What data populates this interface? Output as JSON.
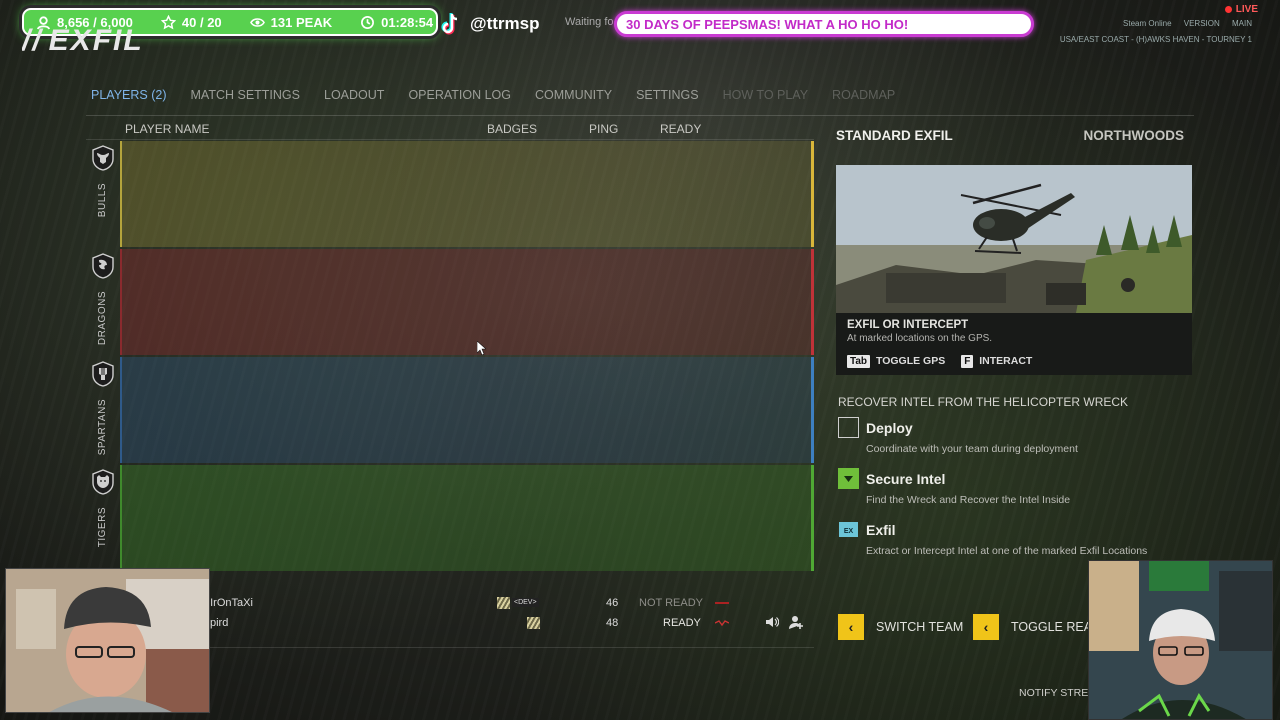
{
  "overlay": {
    "stats": [
      {
        "icon": "user-icon",
        "value": "8,656 / 6,000"
      },
      {
        "icon": "star-icon",
        "value": "40 / 20"
      },
      {
        "icon": "eye-icon",
        "value": "131 PEAK"
      },
      {
        "icon": "clock-icon",
        "value": "01:28:54"
      }
    ],
    "handle": "@ttrmsp",
    "waiting": "Waiting fo",
    "marquee": "30 DAYS OF PEEPSMAS! WHAT A HO HO HO!",
    "live": "LIVE",
    "status_row1": [
      "Steam Online",
      "VERSION",
      "MAIN"
    ],
    "status_row2": "USA/EAST COAST - (H)AWKS HAVEN - TOURNEY 1",
    "stat_color": "#58d14f",
    "marquee_color": "#c93bd2"
  },
  "game": {
    "logo": "EXFIL",
    "tabs": [
      {
        "label": "PLAYERS (2)",
        "state": "active"
      },
      {
        "label": "MATCH SETTINGS",
        "state": "normal"
      },
      {
        "label": "LOADOUT",
        "state": "normal"
      },
      {
        "label": "OPERATION LOG",
        "state": "normal"
      },
      {
        "label": "COMMUNITY",
        "state": "normal"
      },
      {
        "label": "SETTINGS",
        "state": "normal"
      },
      {
        "label": "HOW TO PLAY",
        "state": "dim"
      },
      {
        "label": "ROADMAP",
        "state": "dim"
      }
    ],
    "table_headers": {
      "player_name": "PLAYER NAME",
      "badges": "BADGES",
      "ping": "PING",
      "ready": "READY"
    },
    "teams": [
      {
        "name": "BULLS",
        "color": "#b4a43c",
        "edge": "#d9b63a"
      },
      {
        "name": "DRAGONS",
        "color": "#8a2a2e",
        "edge": "#c03238"
      },
      {
        "name": "SPARTANS",
        "color": "#2f5a8a",
        "edge": "#3d7fc0"
      },
      {
        "name": "TIGERS",
        "color": "#3f8a2c",
        "edge": "#4fa834"
      }
    ],
    "players": [
      {
        "name": "] IrOnTaXi",
        "dev_tag": "<DEV>",
        "ping": "46",
        "ready": "NOT READY"
      },
      {
        "name": "pird",
        "dev_tag": "",
        "ping": "48",
        "ready": "READY"
      }
    ],
    "mode": {
      "name": "STANDARD EXFIL",
      "map": "NORTHWOODS",
      "preview_title": "EXFIL OR INTERCEPT",
      "preview_desc": "At marked locations on the GPS.",
      "key1": "Tab",
      "key1_label": "TOGGLE GPS",
      "key2": "F",
      "key2_label": "INTERACT"
    },
    "objectives_title": "RECOVER INTEL FROM THE HELICOPTER WRECK",
    "objectives": [
      {
        "title": "Deploy",
        "desc": "Coordinate with your team during deployment",
        "icon": "empty-checkbox-icon"
      },
      {
        "title": "Secure Intel",
        "desc": "Find the Wreck and Recover the Intel Inside",
        "icon": "down-triangle-icon"
      },
      {
        "title": "Exfil",
        "desc": "Extract or Intercept Intel at one of the marked Exfil Locations",
        "icon": "ex-icon"
      }
    ],
    "actions": [
      {
        "label": "SWITCH TEAM"
      },
      {
        "label": "TOGGLE READ"
      }
    ],
    "notify": "NOTIFY STREA",
    "accent": "#f0c419"
  }
}
